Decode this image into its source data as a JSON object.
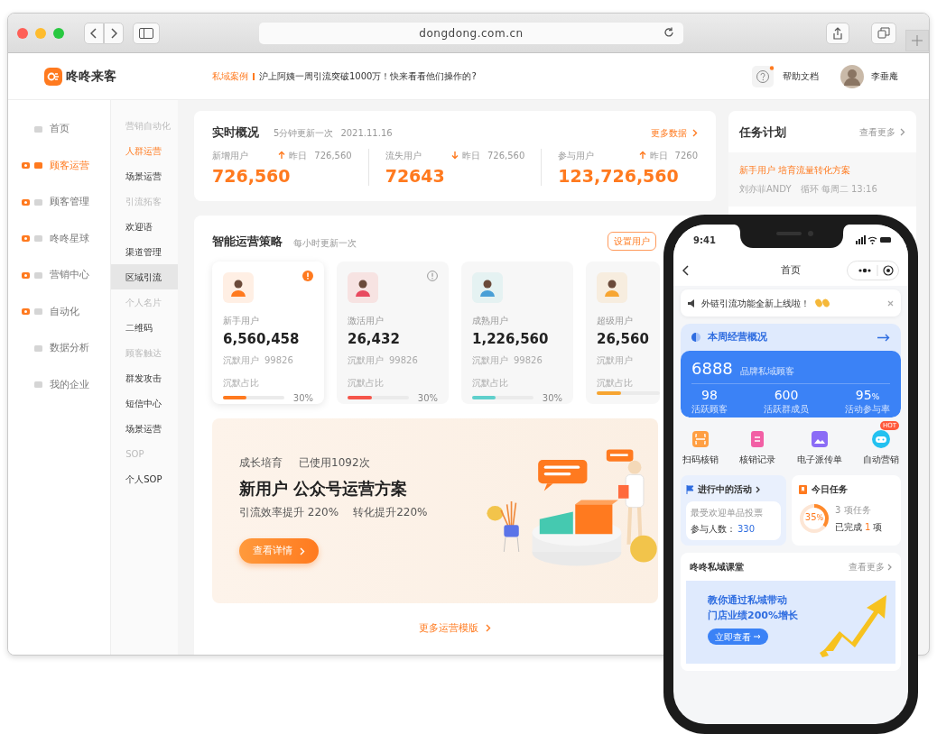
{
  "browser": {
    "url": "dongdong.com.cn"
  },
  "header": {
    "logo": "咚咚来客",
    "notice_tag": "私域案例",
    "notice": "沪上阿姨一周引流突破1000万！快来看看他们操作的?",
    "help": "帮助文档",
    "user": "李垂庵"
  },
  "nav": [
    {
      "label": "首页",
      "selected": false,
      "accent": false
    },
    {
      "label": "顾客运营",
      "selected": true,
      "accent": true
    },
    {
      "label": "顾客管理",
      "selected": false,
      "accent": true
    },
    {
      "label": "咚咚星球",
      "selected": false,
      "accent": true
    },
    {
      "label": "营销中心",
      "selected": false,
      "accent": true
    },
    {
      "label": "自动化",
      "selected": false,
      "accent": true
    },
    {
      "label": "数据分析",
      "selected": false,
      "accent": false
    },
    {
      "label": "我的企业",
      "selected": false,
      "accent": false
    }
  ],
  "subnav": [
    {
      "label": "营销自动化",
      "kind": "heading"
    },
    {
      "label": "人群运营",
      "kind": "link",
      "selected": true,
      "highlighted": false
    },
    {
      "label": "场景运营",
      "kind": "link",
      "selected": false,
      "highlighted": false
    },
    {
      "label": "引流拓客",
      "kind": "heading"
    },
    {
      "label": "欢迎语",
      "kind": "link",
      "selected": false,
      "highlighted": false
    },
    {
      "label": "渠道管理",
      "kind": "link",
      "selected": false,
      "highlighted": false
    },
    {
      "label": "区域引流",
      "kind": "link",
      "selected": false,
      "highlighted": true
    },
    {
      "label": "个人名片",
      "kind": "heading"
    },
    {
      "label": "二维码",
      "kind": "link",
      "selected": false,
      "highlighted": false
    },
    {
      "label": "顾客触达",
      "kind": "heading"
    },
    {
      "label": "群发攻击",
      "kind": "link",
      "selected": false,
      "highlighted": false
    },
    {
      "label": "短信中心",
      "kind": "link",
      "selected": false,
      "highlighted": false
    },
    {
      "label": "场景运营",
      "kind": "link",
      "selected": false,
      "highlighted": false
    },
    {
      "label": "SOP",
      "kind": "heading"
    },
    {
      "label": "个人SOP",
      "kind": "link",
      "selected": false,
      "highlighted": false
    }
  ],
  "realtime": {
    "title": "实时概况",
    "subtitle": "5分钟更新一次",
    "date": "2021.11.16",
    "more": "更多数据",
    "stats": [
      {
        "label": "新增用户",
        "rising": true,
        "yesterday_label": "昨日",
        "yesterday": "726,560",
        "value": "726,560"
      },
      {
        "label": "流失用户",
        "rising": false,
        "yesterday_label": "昨日",
        "yesterday": "726,560",
        "value": "72643"
      },
      {
        "label": "参与用户",
        "rising": true,
        "yesterday_label": "昨日",
        "yesterday": "7260",
        "value": "123,726,560"
      }
    ]
  },
  "tasks": {
    "title": "任务计划",
    "more": "查看更多",
    "items": [
      {
        "title": "新手用户 培育流量转化方案",
        "owner": "刘亦菲ANDY",
        "schedule": "循环 每周二 13:16"
      }
    ]
  },
  "strategy": {
    "title": "智能运营策略",
    "subtitle": "每小时更新一次",
    "button": "设置用户",
    "cards": [
      {
        "name": "新手用户",
        "value": "6,560,458",
        "silent_label": "沉默用户",
        "silent": "99826",
        "ratio_label": "沉默占比",
        "ratio": "30%",
        "level": 0.38,
        "color": "#ff7a1f",
        "selected": true,
        "alert": true,
        "alert_active": true
      },
      {
        "name": "激活用户",
        "value": "26,432",
        "silent_label": "沉默用户",
        "silent": "99826",
        "ratio_label": "沉默占比",
        "ratio": "30%",
        "level": 0.4,
        "color": "#f5554a",
        "selected": false,
        "alert": true,
        "alert_active": false
      },
      {
        "name": "成熟用户",
        "value": "1,226,560",
        "silent_label": "沉默用户",
        "silent": "99826",
        "ratio_label": "沉默占比",
        "ratio": "30%",
        "level": 0.38,
        "color": "#5fd0cc",
        "selected": false,
        "alert": false
      },
      {
        "name": "超级用户",
        "value": "26,560",
        "silent_label": "沉默用户",
        "ratio_label": "沉默占比",
        "level": 0.38,
        "color": "#f7a531",
        "selected": false,
        "alert": false
      }
    ],
    "banner": {
      "tag": "成长培育",
      "usage": "已使用1092次",
      "title": "新用户 公众号运营方案",
      "stats": [
        "引流效率提升 220%",
        "转化提升220%"
      ],
      "button": "查看详情"
    },
    "more": "更多运营模版"
  },
  "phone": {
    "time": "9:41",
    "title": "首页",
    "notice": "外链引流功能全新上线啦！",
    "overview": {
      "title": "本周经营概况",
      "total": "6888",
      "total_label": "品牌私域顾客",
      "stats": [
        {
          "value": "98",
          "label": "活跃顾客"
        },
        {
          "value": "600",
          "label": "活跃群成员"
        },
        {
          "value": "95",
          "unit": "%",
          "label": "活动参与率"
        }
      ]
    },
    "actions": [
      {
        "label": "扫码核销",
        "kind": "scan"
      },
      {
        "label": "核销记录",
        "kind": "ticket"
      },
      {
        "label": "电子派传单",
        "kind": "image"
      },
      {
        "label": "自动营销",
        "kind": "robot",
        "badge": "HOT"
      }
    ],
    "activity": {
      "title": "进行中的活动",
      "name": "最受欢迎单品投票",
      "count_label": "参与人数：",
      "count": "330"
    },
    "today": {
      "title": "今日任务",
      "percent": "35",
      "unit": "%",
      "level": 0.35,
      "total": "3 项任务",
      "done_label": "已完成",
      "done": "1",
      "done_unit": "项"
    },
    "course": {
      "title": "咚咚私域课堂",
      "more": "查看更多",
      "lines": [
        "教你通过私域带动",
        "门店业绩200%增长"
      ],
      "button": "立即查看"
    }
  }
}
